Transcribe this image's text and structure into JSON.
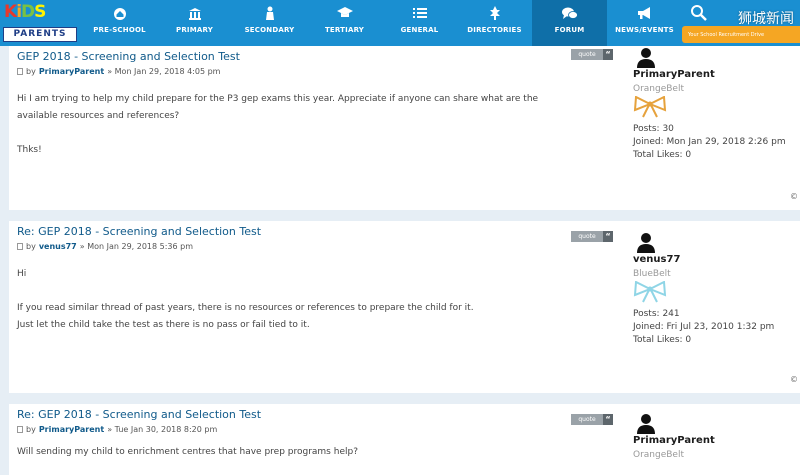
{
  "brand": {
    "logo_top": "KIDS",
    "logo_letters": [
      "K",
      "i",
      "D",
      "S"
    ],
    "logo_colors": [
      "#e8382c",
      "#f5a623",
      "#7ac143",
      "#1f78c8"
    ],
    "logo_bottom": "PARENTS"
  },
  "nav": {
    "items": [
      {
        "label": "PRE-SCHOOL",
        "icon": "home-icon"
      },
      {
        "label": "PRIMARY",
        "icon": "building-icon"
      },
      {
        "label": "SECONDARY",
        "icon": "person-icon"
      },
      {
        "label": "TERTIARY",
        "icon": "graduation-cap-icon"
      },
      {
        "label": "GENERAL",
        "icon": "list-icon"
      },
      {
        "label": "DIRECTORIES",
        "icon": "tree-icon"
      },
      {
        "label": "FORUM",
        "icon": "chat-icon"
      },
      {
        "label": "NEWS/EVENTS",
        "icon": "megaphone-icon"
      }
    ],
    "active_index": 6,
    "promo_text": "Your School Recruitment Drive"
  },
  "watermark": "狮城新闻",
  "colors": {
    "nav": "#1a8fd1",
    "nav_active": "#0f6fa8",
    "title_link": "#105a8a",
    "orange_bow": "#e6a23c",
    "blue_bow": "#8fd5e6"
  },
  "posts": [
    {
      "title": "GEP 2018 - Screening and Selection Test",
      "meta_by": "by",
      "author": "PrimaryParent",
      "date": "» Mon Jan 29, 2018 4:05 pm",
      "quote_label": "quote",
      "body": [
        "Hi I am trying to help my child prepare for the P3 gep exams this year. Appreciate if anyone can share what are the",
        "available resources and references?",
        "",
        "Thks!"
      ],
      "profile": {
        "username": "PrimaryParent",
        "rank": "OrangeBelt",
        "bow_color": "orange",
        "posts_label": "Posts:",
        "posts": "30",
        "joined_label": "Joined:",
        "joined": "Mon Jan 29, 2018 2:26 pm",
        "likes_label": "Total Likes:",
        "likes": "0"
      }
    },
    {
      "title": "Re: GEP 2018 - Screening and Selection Test",
      "meta_by": "by",
      "author": "venus77",
      "date": "» Mon Jan 29, 2018 5:36 pm",
      "quote_label": "quote",
      "body": [
        "Hi",
        "",
        "If you read similar thread of past years, there is no resources or references to prepare the child for it.",
        "Just let the child take the test as there is no pass or fail tied to it."
      ],
      "profile": {
        "username": "venus77",
        "rank": "BlueBelt",
        "bow_color": "blue",
        "posts_label": "Posts:",
        "posts": "241",
        "joined_label": "Joined:",
        "joined": "Fri Jul 23, 2010 1:32 pm",
        "likes_label": "Total Likes:",
        "likes": "0"
      }
    },
    {
      "title": "Re: GEP 2018 - Screening and Selection Test",
      "meta_by": "by",
      "author": "PrimaryParent",
      "date": "» Tue Jan 30, 2018 8:20 pm",
      "quote_label": "quote",
      "body": [
        "Will sending my child to enrichment centres that have prep programs help?"
      ],
      "profile": {
        "username": "PrimaryParent",
        "rank": "OrangeBelt",
        "bow_color": "orange"
      }
    }
  ]
}
